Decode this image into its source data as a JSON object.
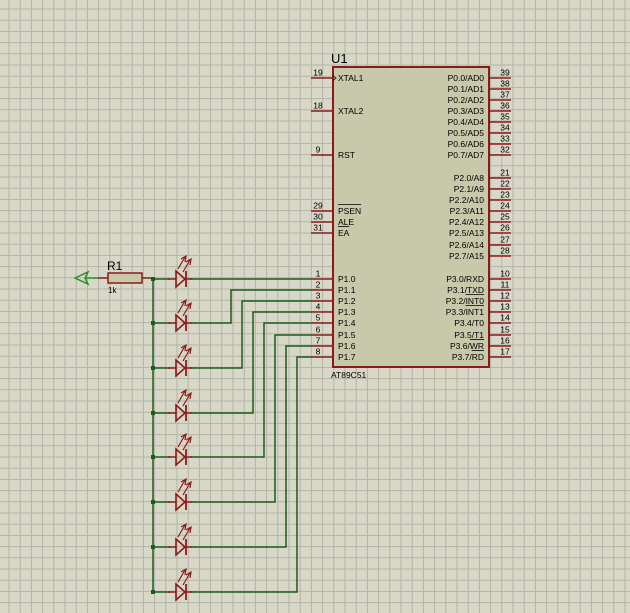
{
  "chip": {
    "ref": "U1",
    "part": "AT89C51",
    "left_pins": [
      {
        "num": "19",
        "name": "XTAL1"
      },
      {
        "num": "18",
        "name": "XTAL2"
      },
      {
        "num": "9",
        "name": "RST"
      },
      {
        "num": "29",
        "name": "PSEN",
        "overline": true
      },
      {
        "num": "30",
        "name": "ALE"
      },
      {
        "num": "31",
        "name": "EA",
        "overline": true
      },
      {
        "num": "1",
        "name": "P1.0"
      },
      {
        "num": "2",
        "name": "P1.1"
      },
      {
        "num": "3",
        "name": "P1.2"
      },
      {
        "num": "4",
        "name": "P1.3"
      },
      {
        "num": "5",
        "name": "P1.4"
      },
      {
        "num": "6",
        "name": "P1.5"
      },
      {
        "num": "7",
        "name": "P1.6"
      },
      {
        "num": "8",
        "name": "P1.7"
      }
    ],
    "right_pins": [
      {
        "num": "39",
        "name": "P0.0/AD0"
      },
      {
        "num": "38",
        "name": "P0.1/AD1"
      },
      {
        "num": "37",
        "name": "P0.2/AD2"
      },
      {
        "num": "36",
        "name": "P0.3/AD3"
      },
      {
        "num": "35",
        "name": "P0.4/AD4"
      },
      {
        "num": "34",
        "name": "P0.5/AD5"
      },
      {
        "num": "33",
        "name": "P0.6/AD6"
      },
      {
        "num": "32",
        "name": "P0.7/AD7"
      },
      {
        "num": "21",
        "name": "P2.0/A8"
      },
      {
        "num": "22",
        "name": "P2.1/A9"
      },
      {
        "num": "23",
        "name": "P2.2/A10"
      },
      {
        "num": "24",
        "name": "P2.3/A11"
      },
      {
        "num": "25",
        "name": "P2.4/A12"
      },
      {
        "num": "26",
        "name": "P2.5/A13"
      },
      {
        "num": "27",
        "name": "P2.6/A14"
      },
      {
        "num": "28",
        "name": "P2.7/A15"
      },
      {
        "num": "10",
        "name": "P3.0/RXD"
      },
      {
        "num": "11",
        "name": "P3.1/TXD"
      },
      {
        "num": "12",
        "name": "P3.2/INT0",
        "over_from": 5
      },
      {
        "num": "13",
        "name": "P3.3/INT1",
        "over_from": 5
      },
      {
        "num": "14",
        "name": "P3.4/T0"
      },
      {
        "num": "15",
        "name": "P3.5/T1"
      },
      {
        "num": "16",
        "name": "P3.6/WR",
        "over_from": 5
      },
      {
        "num": "17",
        "name": "P3.7/RD",
        "over_from": 5
      }
    ]
  },
  "resistor": {
    "ref": "R1",
    "value": "1k"
  },
  "led_count": 8,
  "colors": {
    "background": "#d8d8c8",
    "grid": "#b4b4a6",
    "component": "#8c1a1a",
    "chip_fill": "#c8c8aa",
    "wire": "#1a5c1a",
    "terminal": "#2e8b2e"
  }
}
